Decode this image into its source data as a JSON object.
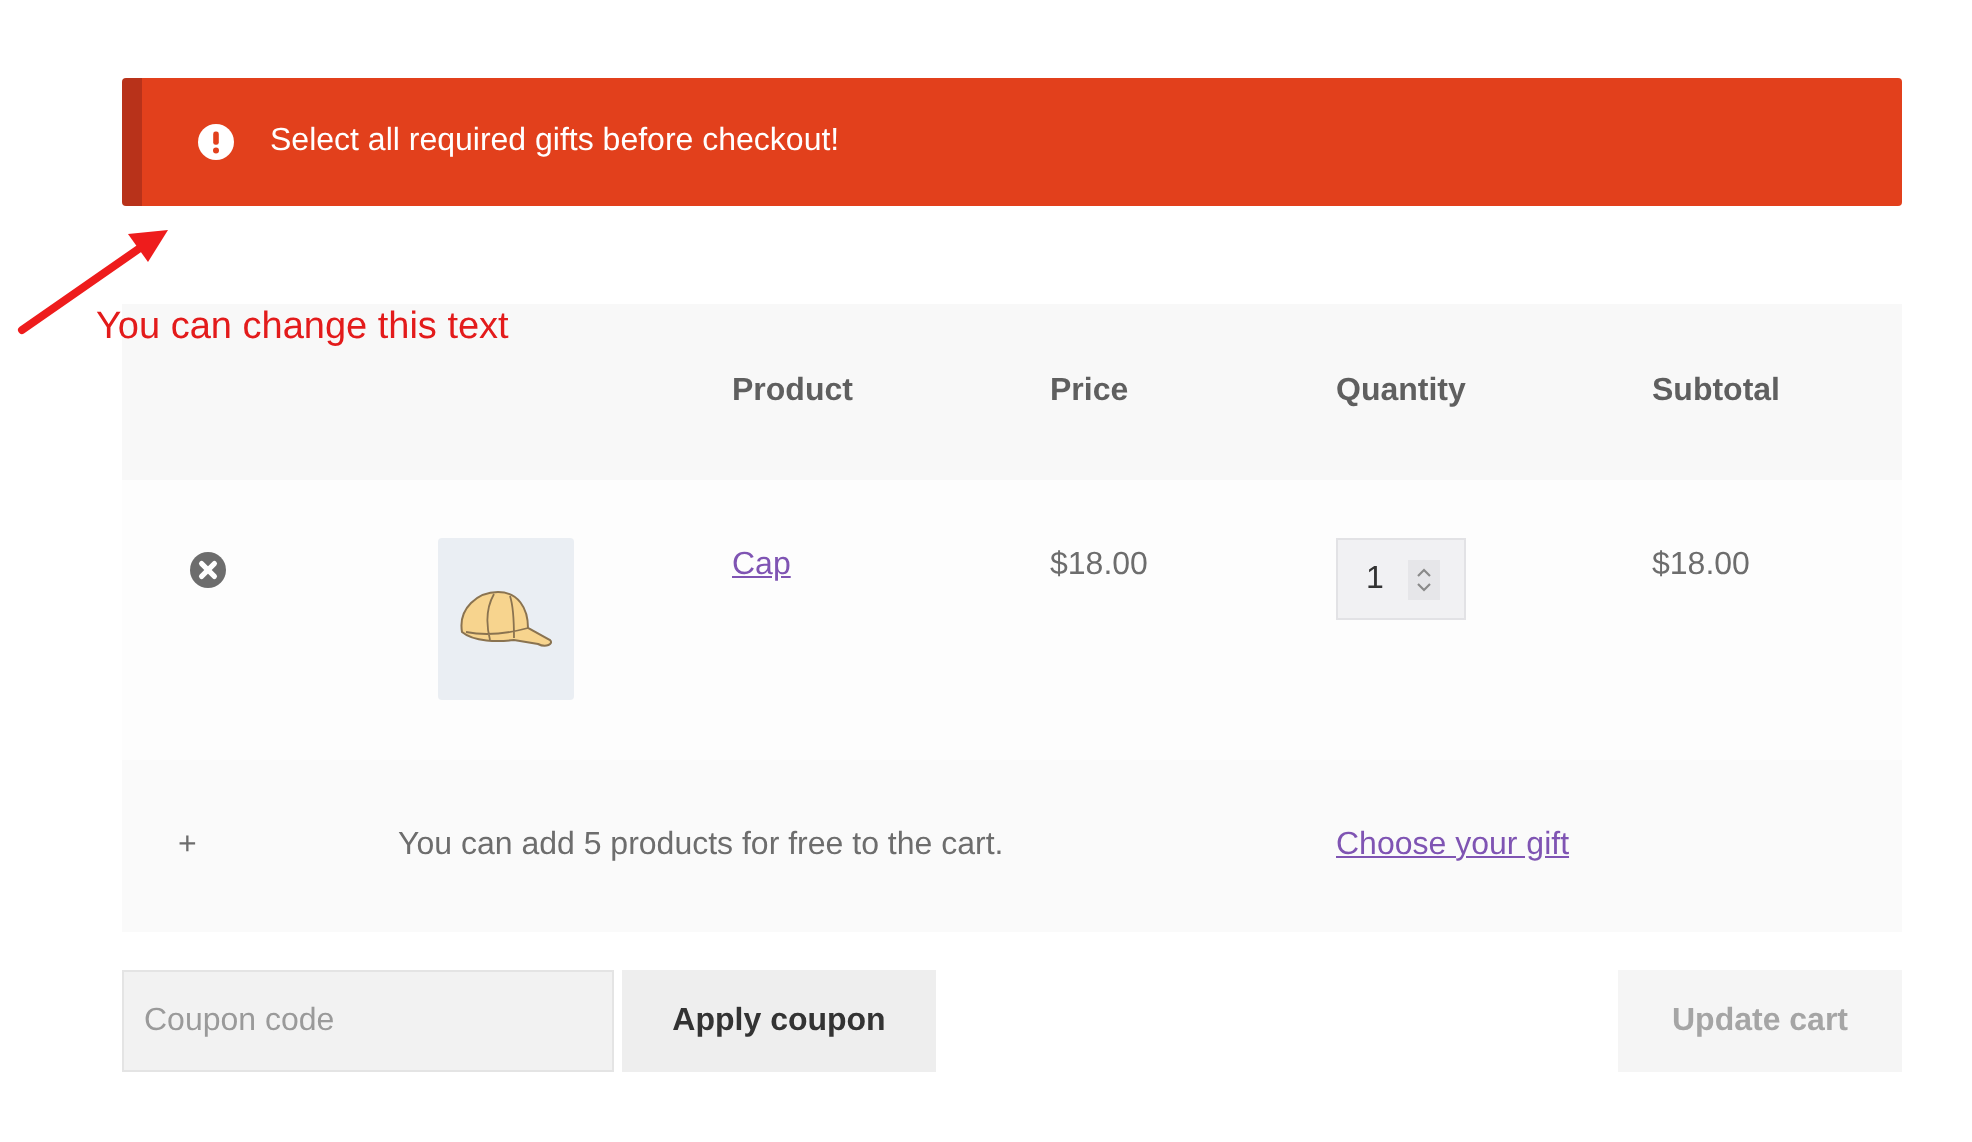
{
  "notice": {
    "message": "Select all required gifts before checkout!"
  },
  "annotation": {
    "text": "You can change this text"
  },
  "cart_table": {
    "columns": [
      "Product",
      "Price",
      "Quantity",
      "Subtotal"
    ],
    "items": [
      {
        "name": "Cap",
        "price": "$18.00",
        "quantity": "1",
        "subtotal": "$18.00"
      }
    ]
  },
  "gift_row": {
    "icon": "+",
    "message": "You can add 5 products for free to the cart.",
    "link": "Choose your gift"
  },
  "coupon": {
    "placeholder": "Coupon code",
    "button": "Apply coupon"
  },
  "update_button": {
    "label": "Update cart",
    "disabled": true
  }
}
